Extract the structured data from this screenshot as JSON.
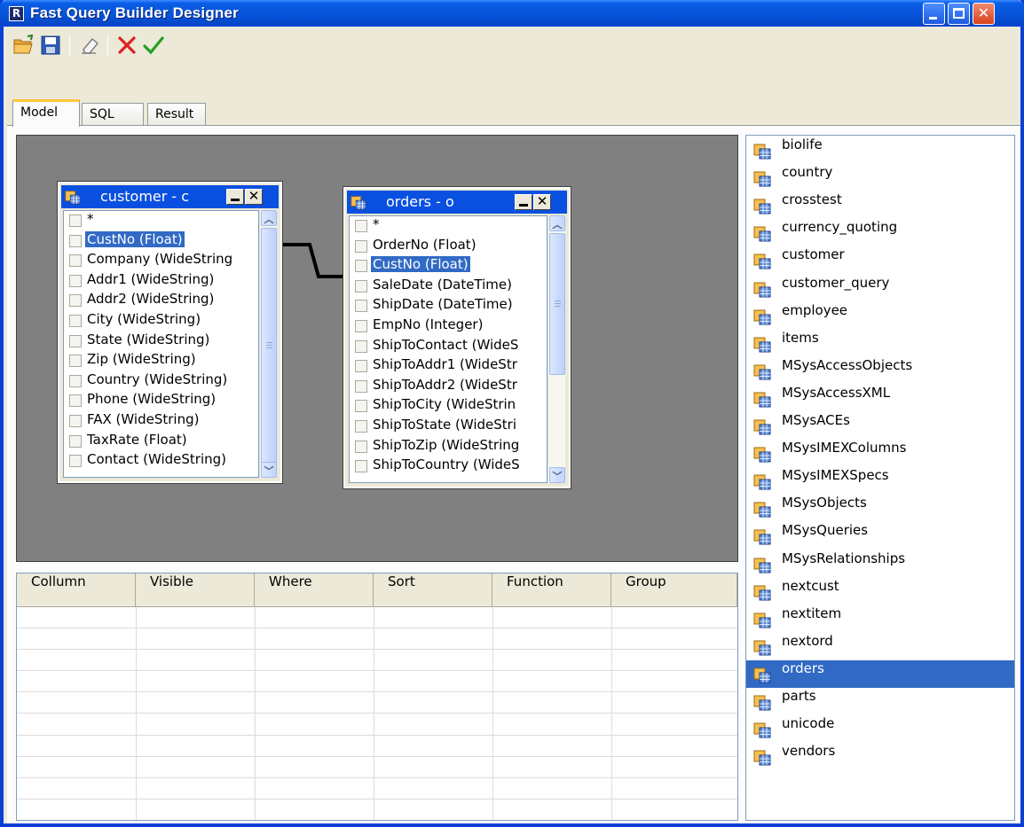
{
  "window": {
    "title": "Fast Query Builder  Designer",
    "app_icon_letter": "R"
  },
  "toolbar": {
    "buttons": [
      "open-icon",
      "save-icon",
      "eraser-icon",
      "cancel-icon",
      "ok-icon"
    ]
  },
  "tabs": [
    {
      "label": "Model",
      "active": true
    },
    {
      "label": "SQL",
      "active": false
    },
    {
      "label": "Result",
      "active": false
    }
  ],
  "model": {
    "tables": [
      {
        "title": "customer - c",
        "fields": [
          "*",
          "CustNo (Float)",
          "Company (WideString",
          "Addr1 (WideString)",
          "Addr2 (WideString)",
          "City (WideString)",
          "State (WideString)",
          "Zip (WideString)",
          "Country (WideString)",
          "Phone (WideString)",
          "FAX (WideString)",
          "TaxRate (Float)",
          "Contact (WideString)"
        ],
        "selected_field": "CustNo (Float)"
      },
      {
        "title": "orders - o",
        "fields": [
          "*",
          "OrderNo (Float)",
          "CustNo (Float)",
          "SaleDate (DateTime)",
          "ShipDate (DateTime)",
          "EmpNo (Integer)",
          "ShipToContact (WideS",
          "ShipToAddr1 (WideStr",
          "ShipToAddr2 (WideStr",
          "ShipToCity (WideStrin",
          "ShipToState (WideStri",
          "ShipToZip (WideString",
          "ShipToCountry (WideS"
        ],
        "selected_field": "CustNo (Float)"
      }
    ]
  },
  "grid": {
    "columns": [
      "Collumn",
      "Visible",
      "Where",
      "Sort",
      "Function",
      "Group"
    ],
    "rows": 10
  },
  "table_list": {
    "items": [
      "biolife",
      "country",
      "crosstest",
      "currency_quoting",
      "customer",
      "customer_query",
      "employee",
      "items",
      "MSysAccessObjects",
      "MSysAccessXML",
      "MSysACEs",
      "MSysIMEXColumns",
      "MSysIMEXSpecs",
      "MSysObjects",
      "MSysQueries",
      "MSysRelationships",
      "nextcust",
      "nextitem",
      "nextord",
      "orders",
      "parts",
      "unicode",
      "vendors"
    ],
    "selected": "orders"
  },
  "colors": {
    "title_blue": "#0a50e0",
    "selection": "#316ac5",
    "canvas_gray": "#808080",
    "window_face": "#ece9d8"
  }
}
